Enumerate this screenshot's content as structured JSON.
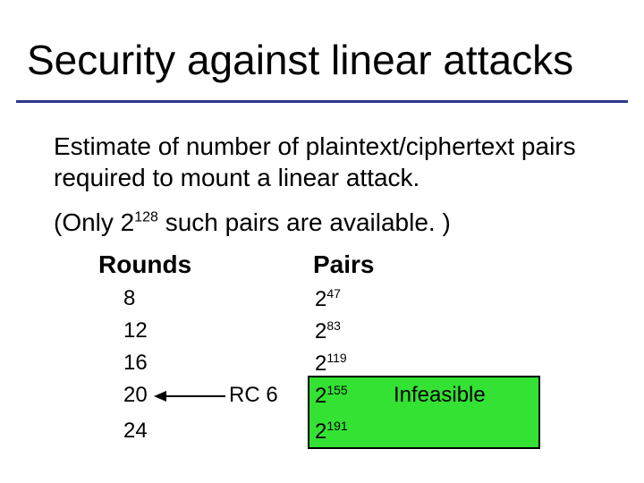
{
  "title": "Security against linear attacks",
  "intro": "Estimate of number of plaintext/ciphertext pairs required to mount a linear attack.",
  "avail_prefix": "(Only 2",
  "avail_exp": "128",
  "avail_suffix": " such pairs are available. )",
  "headers": {
    "rounds": "Rounds",
    "pairs": "Pairs"
  },
  "rows": {
    "r0": {
      "rounds": "8",
      "base": "2",
      "exp": "47"
    },
    "r1": {
      "rounds": "12",
      "base": "2",
      "exp": "83"
    },
    "r2": {
      "rounds": "16",
      "base": "2",
      "exp": "119"
    },
    "r3": {
      "rounds": "20",
      "base": "2",
      "exp": "155"
    },
    "r4": {
      "rounds": "24",
      "base": "2",
      "exp": "191"
    }
  },
  "rc6_label": "RC 6",
  "infeasible": "Infeasible",
  "colors": {
    "accent_rule": "#2a3a8a",
    "highlight": "#33e233"
  },
  "chart_data": {
    "type": "table",
    "title": "Security against linear attacks",
    "columns": [
      "Rounds",
      "Pairs (as power of 2)"
    ],
    "rows": [
      {
        "rounds": 8,
        "pairs_exp": 47
      },
      {
        "rounds": 12,
        "pairs_exp": 83
      },
      {
        "rounds": 16,
        "pairs_exp": 119
      },
      {
        "rounds": 20,
        "pairs_exp": 155,
        "note": "RC6",
        "infeasible": true
      },
      {
        "rounds": 24,
        "pairs_exp": 191,
        "infeasible": true
      }
    ],
    "available_pairs_exp": 128
  }
}
